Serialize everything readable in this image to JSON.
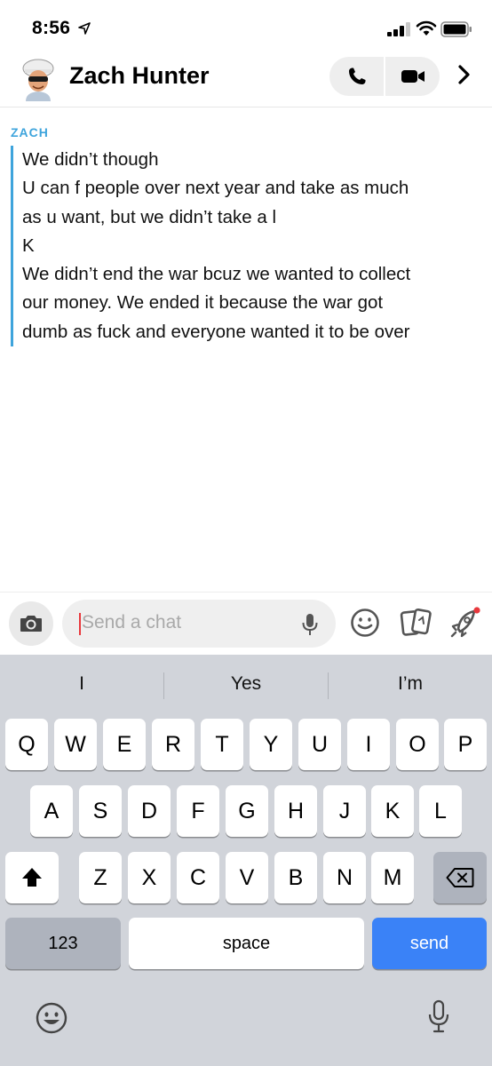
{
  "status_bar": {
    "time": "8:56"
  },
  "header": {
    "contact_name": "Zach Hunter"
  },
  "conversation": {
    "sender": "ZACH",
    "lines": [
      "We didn’t though",
      "U can f people over next year and take as much",
      "as u want, but we didn’t take a l",
      "K",
      "We didn’t end the war bcuz we wanted to collect",
      "our money. We ended it because the war got",
      "dumb as fuck and everyone wanted it to be over"
    ]
  },
  "chat_input": {
    "placeholder": "Send a chat",
    "value": ""
  },
  "keyboard": {
    "suggestions": [
      "I",
      "Yes",
      "I’m"
    ],
    "row1": [
      "Q",
      "W",
      "E",
      "R",
      "T",
      "Y",
      "U",
      "I",
      "O",
      "P"
    ],
    "row2": [
      "A",
      "S",
      "D",
      "F",
      "G",
      "H",
      "J",
      "K",
      "L"
    ],
    "row3": [
      "Z",
      "X",
      "C",
      "V",
      "B",
      "N",
      "M"
    ],
    "numbers_label": "123",
    "space_label": "space",
    "send_label": "send"
  },
  "colors": {
    "accent_blue": "#3ea4dc",
    "send_key": "#3a82f7",
    "caret": "#e8383d",
    "notification_dot": "#e8383d"
  },
  "icons": [
    "location-arrow-icon",
    "signal-icon",
    "wifi-icon",
    "battery-icon",
    "phone-icon",
    "video-icon",
    "chevron-right-icon",
    "camera-icon",
    "microphone-icon",
    "emoji-icon",
    "cards-icon",
    "rocket-icon",
    "shift-icon",
    "backspace-icon",
    "keyboard-emoji-icon",
    "dictation-icon"
  ]
}
